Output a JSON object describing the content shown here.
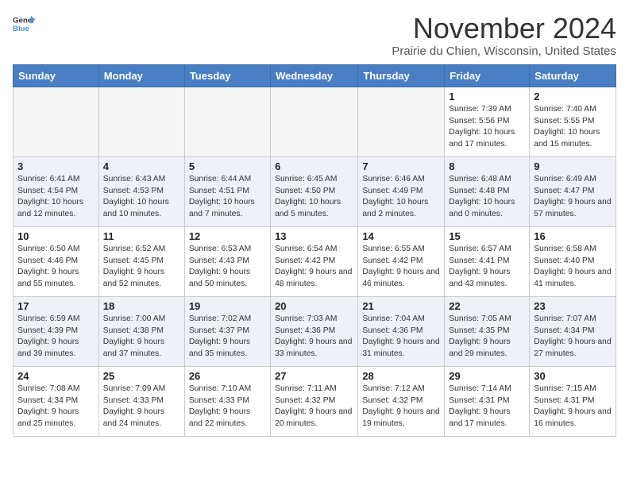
{
  "logo": {
    "general": "General",
    "blue": "Blue"
  },
  "title": "November 2024",
  "location": "Prairie du Chien, Wisconsin, United States",
  "weekdays": [
    "Sunday",
    "Monday",
    "Tuesday",
    "Wednesday",
    "Thursday",
    "Friday",
    "Saturday"
  ],
  "weeks": [
    [
      {
        "day": "",
        "info": ""
      },
      {
        "day": "",
        "info": ""
      },
      {
        "day": "",
        "info": ""
      },
      {
        "day": "",
        "info": ""
      },
      {
        "day": "",
        "info": ""
      },
      {
        "day": "1",
        "info": "Sunrise: 7:39 AM\nSunset: 5:56 PM\nDaylight: 10 hours and 17 minutes."
      },
      {
        "day": "2",
        "info": "Sunrise: 7:40 AM\nSunset: 5:55 PM\nDaylight: 10 hours and 15 minutes."
      }
    ],
    [
      {
        "day": "3",
        "info": "Sunrise: 6:41 AM\nSunset: 4:54 PM\nDaylight: 10 hours and 12 minutes."
      },
      {
        "day": "4",
        "info": "Sunrise: 6:43 AM\nSunset: 4:53 PM\nDaylight: 10 hours and 10 minutes."
      },
      {
        "day": "5",
        "info": "Sunrise: 6:44 AM\nSunset: 4:51 PM\nDaylight: 10 hours and 7 minutes."
      },
      {
        "day": "6",
        "info": "Sunrise: 6:45 AM\nSunset: 4:50 PM\nDaylight: 10 hours and 5 minutes."
      },
      {
        "day": "7",
        "info": "Sunrise: 6:46 AM\nSunset: 4:49 PM\nDaylight: 10 hours and 2 minutes."
      },
      {
        "day": "8",
        "info": "Sunrise: 6:48 AM\nSunset: 4:48 PM\nDaylight: 10 hours and 0 minutes."
      },
      {
        "day": "9",
        "info": "Sunrise: 6:49 AM\nSunset: 4:47 PM\nDaylight: 9 hours and 57 minutes."
      }
    ],
    [
      {
        "day": "10",
        "info": "Sunrise: 6:50 AM\nSunset: 4:46 PM\nDaylight: 9 hours and 55 minutes."
      },
      {
        "day": "11",
        "info": "Sunrise: 6:52 AM\nSunset: 4:45 PM\nDaylight: 9 hours and 52 minutes."
      },
      {
        "day": "12",
        "info": "Sunrise: 6:53 AM\nSunset: 4:43 PM\nDaylight: 9 hours and 50 minutes."
      },
      {
        "day": "13",
        "info": "Sunrise: 6:54 AM\nSunset: 4:42 PM\nDaylight: 9 hours and 48 minutes."
      },
      {
        "day": "14",
        "info": "Sunrise: 6:55 AM\nSunset: 4:42 PM\nDaylight: 9 hours and 46 minutes."
      },
      {
        "day": "15",
        "info": "Sunrise: 6:57 AM\nSunset: 4:41 PM\nDaylight: 9 hours and 43 minutes."
      },
      {
        "day": "16",
        "info": "Sunrise: 6:58 AM\nSunset: 4:40 PM\nDaylight: 9 hours and 41 minutes."
      }
    ],
    [
      {
        "day": "17",
        "info": "Sunrise: 6:59 AM\nSunset: 4:39 PM\nDaylight: 9 hours and 39 minutes."
      },
      {
        "day": "18",
        "info": "Sunrise: 7:00 AM\nSunset: 4:38 PM\nDaylight: 9 hours and 37 minutes."
      },
      {
        "day": "19",
        "info": "Sunrise: 7:02 AM\nSunset: 4:37 PM\nDaylight: 9 hours and 35 minutes."
      },
      {
        "day": "20",
        "info": "Sunrise: 7:03 AM\nSunset: 4:36 PM\nDaylight: 9 hours and 33 minutes."
      },
      {
        "day": "21",
        "info": "Sunrise: 7:04 AM\nSunset: 4:36 PM\nDaylight: 9 hours and 31 minutes."
      },
      {
        "day": "22",
        "info": "Sunrise: 7:05 AM\nSunset: 4:35 PM\nDaylight: 9 hours and 29 minutes."
      },
      {
        "day": "23",
        "info": "Sunrise: 7:07 AM\nSunset: 4:34 PM\nDaylight: 9 hours and 27 minutes."
      }
    ],
    [
      {
        "day": "24",
        "info": "Sunrise: 7:08 AM\nSunset: 4:34 PM\nDaylight: 9 hours and 25 minutes."
      },
      {
        "day": "25",
        "info": "Sunrise: 7:09 AM\nSunset: 4:33 PM\nDaylight: 9 hours and 24 minutes."
      },
      {
        "day": "26",
        "info": "Sunrise: 7:10 AM\nSunset: 4:33 PM\nDaylight: 9 hours and 22 minutes."
      },
      {
        "day": "27",
        "info": "Sunrise: 7:11 AM\nSunset: 4:32 PM\nDaylight: 9 hours and 20 minutes."
      },
      {
        "day": "28",
        "info": "Sunrise: 7:12 AM\nSunset: 4:32 PM\nDaylight: 9 hours and 19 minutes."
      },
      {
        "day": "29",
        "info": "Sunrise: 7:14 AM\nSunset: 4:31 PM\nDaylight: 9 hours and 17 minutes."
      },
      {
        "day": "30",
        "info": "Sunrise: 7:15 AM\nSunset: 4:31 PM\nDaylight: 9 hours and 16 minutes."
      }
    ]
  ]
}
